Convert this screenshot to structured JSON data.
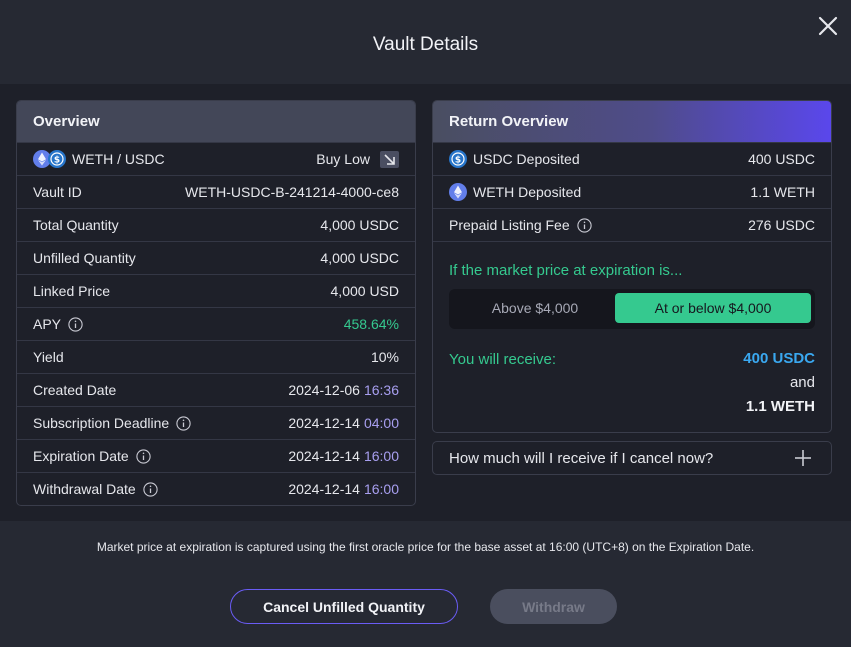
{
  "modal": {
    "title": "Vault Details"
  },
  "overview": {
    "heading": "Overview",
    "pair": "WETH / USDC",
    "direction": "Buy Low",
    "rows": [
      {
        "label": "Vault ID",
        "value": "WETH-USDC-B-241214-4000-ce8"
      },
      {
        "label": "Total Quantity",
        "value": "4,000 USDC"
      },
      {
        "label": "Unfilled Quantity",
        "value": "4,000 USDC"
      },
      {
        "label": "Linked Price",
        "value": "4,000 USD"
      },
      {
        "label": "APY",
        "value": "458.64%"
      },
      {
        "label": "Yield",
        "value": "10%"
      },
      {
        "label": "Created Date",
        "date": "2024-12-06",
        "time": "16:36"
      },
      {
        "label": "Subscription Deadline",
        "date": "2024-12-14",
        "time": "04:00"
      },
      {
        "label": "Expiration Date",
        "date": "2024-12-14",
        "time": "16:00"
      },
      {
        "label": "Withdrawal Date",
        "date": "2024-12-14",
        "time": "16:00"
      }
    ]
  },
  "return_overview": {
    "heading": "Return Overview",
    "rows": [
      {
        "label": "USDC Deposited",
        "value": "400 USDC"
      },
      {
        "label": "WETH Deposited",
        "value": "1.1 WETH"
      },
      {
        "label": "Prepaid Listing Fee",
        "value": "276 USDC"
      }
    ],
    "scenario_question": "If the market price at expiration is...",
    "options": {
      "above": "Above $4,000",
      "below": "At or below $4,000",
      "selected": "below"
    },
    "receive_label": "You will receive:",
    "receive_value_1": "400 USDC",
    "receive_and": "and",
    "receive_value_2": "1.1 WETH"
  },
  "cancel_calc": {
    "label": "How much will I receive if I cancel now?"
  },
  "footer": {
    "disclaimer": "Market price at expiration is captured using the first oracle price for the base asset at 16:00 (UTC+8) on the Expiration Date.",
    "cancel_button": "Cancel Unfilled Quantity",
    "withdraw_button": "Withdraw"
  },
  "icons": {
    "close": "close-icon",
    "eth": "eth-icon",
    "usdc": "usdc-icon",
    "info": "info-icon",
    "arrow": "arrow-down-right-icon",
    "plus": "plus-icon"
  },
  "colors": {
    "accent_green": "#35c98f",
    "accent_blue": "#3aa8f0",
    "accent_purple": "#5a47ec",
    "time_purple": "#a89ff0"
  }
}
